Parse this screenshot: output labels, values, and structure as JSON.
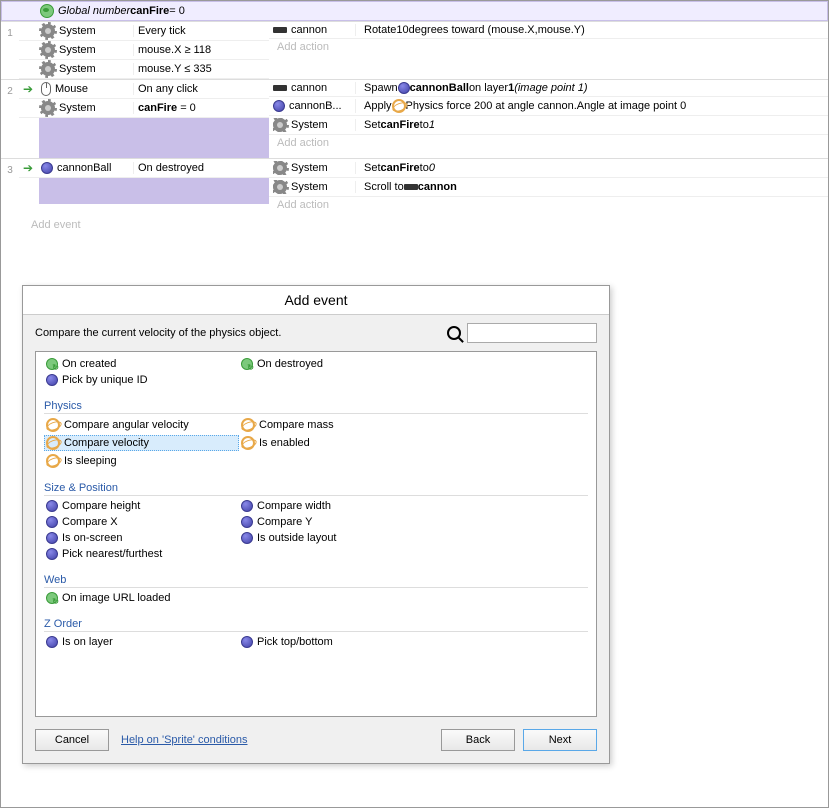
{
  "global": {
    "prefix": "Global number ",
    "name": "canFire",
    "eq": " = 0"
  },
  "events": [
    {
      "num": "1",
      "conditions": [
        {
          "icon": "gear",
          "obj": "System",
          "text": "Every tick"
        },
        {
          "icon": "gear",
          "obj": "System",
          "text": "mouse.X ≥ 118"
        },
        {
          "icon": "gear",
          "obj": "System",
          "text": "mouse.Y ≤ 335"
        }
      ],
      "actions": [
        {
          "icon": "cannon",
          "obj": "cannon",
          "parts": [
            "Rotate ",
            "10",
            " degrees toward (",
            "mouse.X",
            ", ",
            "mouse.Y",
            ")"
          ]
        }
      ]
    },
    {
      "num": "2",
      "arrow": true,
      "conditions": [
        {
          "icon": "mouse",
          "obj": "Mouse",
          "text": "On any click"
        },
        {
          "icon": "gear",
          "obj": "System",
          "html": "<b>canFire</b> = 0"
        }
      ],
      "actions": [
        {
          "icon": "cannon",
          "obj": "cannon",
          "parts": [
            "Spawn ",
            "@ball",
            " ",
            "<b>cannonBall</b>",
            " on layer ",
            "<b>1</b>",
            " ",
            "<i>(image point 1)</i>"
          ]
        },
        {
          "icon": "ball",
          "obj": "cannonB...",
          "parts": [
            "Apply ",
            "@physics",
            " Physics force 200 at angle cannon.Angle at image point 0"
          ]
        },
        {
          "icon": "gear",
          "obj": "System",
          "parts": [
            "Set ",
            "<b>canFire</b>",
            " to ",
            "<i>1</i>"
          ]
        }
      ]
    },
    {
      "num": "3",
      "arrow": true,
      "conditions": [
        {
          "icon": "ball",
          "obj": "cannonBall",
          "text": "On destroyed"
        }
      ],
      "actions": [
        {
          "icon": "gear",
          "obj": "System",
          "parts": [
            "Set ",
            "<b>canFire</b>",
            " to ",
            "<i>0</i>"
          ]
        },
        {
          "icon": "gear",
          "obj": "System",
          "parts": [
            "Scroll to ",
            "@cannon",
            " ",
            "<b>cannon</b>"
          ]
        }
      ]
    }
  ],
  "addAction": "Add action",
  "addEvent": "Add event",
  "dialog": {
    "title": "Add event",
    "desc": "Compare the current velocity of the physics object.",
    "cats": [
      {
        "name": "",
        "items": [
          {
            "icon": "globe",
            "label": "On created"
          },
          {
            "icon": "globe",
            "label": "On destroyed"
          },
          {
            "icon": "ball",
            "label": "Pick by unique ID"
          }
        ]
      },
      {
        "name": "Physics",
        "items": [
          {
            "icon": "physics",
            "label": "Compare angular velocity"
          },
          {
            "icon": "physics",
            "label": "Compare mass"
          },
          {
            "icon": "physics",
            "label": "Compare velocity",
            "selected": true
          },
          {
            "icon": "physics",
            "label": "Is enabled"
          },
          {
            "icon": "physics",
            "label": "Is sleeping"
          }
        ]
      },
      {
        "name": "Size & Position",
        "items": [
          {
            "icon": "ball",
            "label": "Compare height"
          },
          {
            "icon": "ball",
            "label": "Compare width"
          },
          {
            "icon": "ball",
            "label": "Compare X"
          },
          {
            "icon": "ball",
            "label": "Compare Y"
          },
          {
            "icon": "ball",
            "label": "Is on-screen"
          },
          {
            "icon": "ball",
            "label": "Is outside layout"
          },
          {
            "icon": "ball",
            "label": "Pick nearest/furthest"
          }
        ]
      },
      {
        "name": "Web",
        "items": [
          {
            "icon": "globe",
            "label": "On image URL loaded"
          }
        ]
      },
      {
        "name": "Z Order",
        "items": [
          {
            "icon": "ball",
            "label": "Is on layer"
          },
          {
            "icon": "ball",
            "label": "Pick top/bottom"
          }
        ]
      }
    ],
    "cancel": "Cancel",
    "help": "Help on 'Sprite' conditions",
    "back": "Back",
    "next": "Next"
  }
}
